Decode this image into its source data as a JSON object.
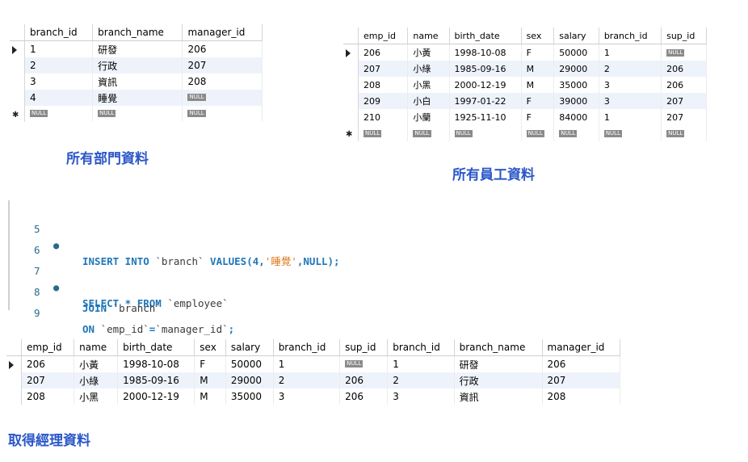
{
  "branch_table": {
    "columns": [
      "branch_id",
      "branch_name",
      "manager_id"
    ],
    "rows": [
      [
        "1",
        "研發",
        "206"
      ],
      [
        "2",
        "行政",
        "207"
      ],
      [
        "3",
        "資訊",
        "208"
      ],
      [
        "4",
        "睡覺",
        "NULL"
      ]
    ],
    "new_row": [
      "NULL",
      "NULL",
      "NULL"
    ]
  },
  "caption_branch": "所有部門資料",
  "employee_table": {
    "columns": [
      "emp_id",
      "name",
      "birth_date",
      "sex",
      "salary",
      "branch_id",
      "sup_id"
    ],
    "rows": [
      [
        "206",
        "小黃",
        "1998-10-08",
        "F",
        "50000",
        "1",
        "NULL"
      ],
      [
        "207",
        "小綠",
        "1985-09-16",
        "M",
        "29000",
        "2",
        "206"
      ],
      [
        "208",
        "小黑",
        "2000-12-19",
        "M",
        "35000",
        "3",
        "206"
      ],
      [
        "209",
        "小白",
        "1997-01-22",
        "F",
        "39000",
        "3",
        "207"
      ],
      [
        "210",
        "小蘭",
        "1925-11-10",
        "F",
        "84000",
        "1",
        "207"
      ]
    ],
    "new_row": [
      "NULL",
      "NULL",
      "NULL",
      "NULL",
      "NULL",
      "NULL",
      "NULL"
    ]
  },
  "caption_employee": "所有員工資料",
  "editor": {
    "lines": [
      {
        "num": "5",
        "marker": "●",
        "p1": "INSERT INTO ",
        "p2": "`branch`",
        "p3": " VALUES(",
        "p4": "4",
        "p5": ",",
        "p6": "'睡覺'",
        "p7": ",NULL);"
      },
      {
        "num": "6"
      },
      {
        "num": "7",
        "marker": "●",
        "p1": "SELECT * FROM ",
        "p2": "`employee`"
      },
      {
        "num": "8",
        "p1": "JOIN ",
        "p2": "`branch`"
      },
      {
        "num": "9",
        "p1": "ON ",
        "p2": "`emp_id`",
        "p3": "=",
        "p4": "`manager_id`",
        "p5": ";"
      }
    ]
  },
  "result_table": {
    "columns": [
      "emp_id",
      "name",
      "birth_date",
      "sex",
      "salary",
      "branch_id",
      "sup_id",
      "branch_id",
      "branch_name",
      "manager_id"
    ],
    "rows": [
      [
        "206",
        "小黃",
        "1998-10-08",
        "F",
        "50000",
        "1",
        "NULL",
        "1",
        "研發",
        "206"
      ],
      [
        "207",
        "小綠",
        "1985-09-16",
        "M",
        "29000",
        "2",
        "206",
        "2",
        "行政",
        "207"
      ],
      [
        "208",
        "小黑",
        "2000-12-19",
        "M",
        "35000",
        "3",
        "206",
        "3",
        "資訊",
        "208"
      ]
    ]
  },
  "caption_result": "取得經理資料",
  "colors": {
    "caption": "#2b57c8",
    "keyword": "#2077b8",
    "string": "#e0791f",
    "alt_row": "#eef3fb"
  }
}
